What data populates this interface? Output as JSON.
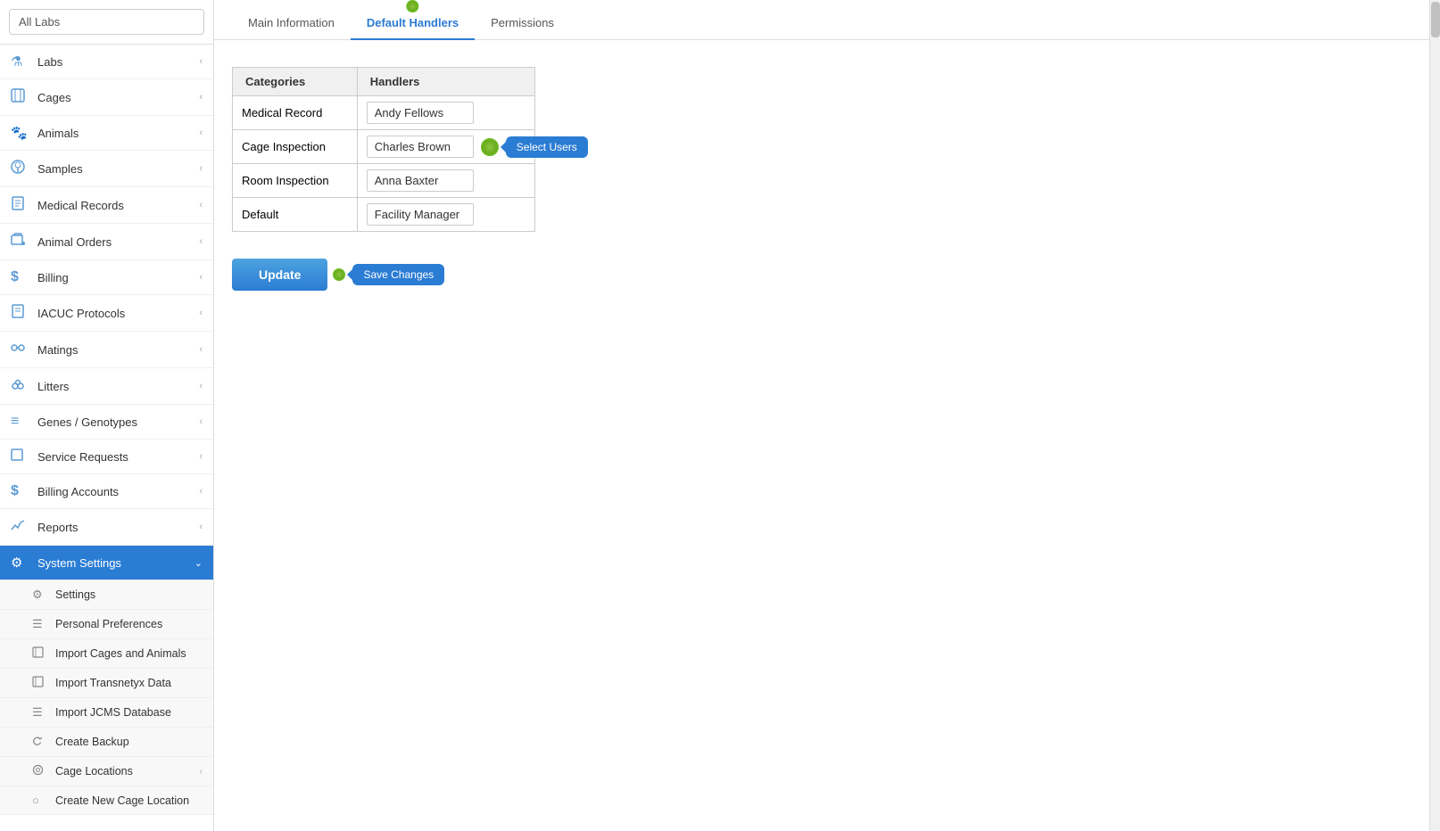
{
  "sidebar": {
    "search_placeholder": "All Labs",
    "items": [
      {
        "id": "labs",
        "label": "Labs",
        "icon": "⚗",
        "has_chevron": true
      },
      {
        "id": "cages",
        "label": "Cages",
        "icon": "🐾",
        "has_chevron": true
      },
      {
        "id": "animals",
        "label": "Animals",
        "icon": "🐾",
        "has_chevron": true
      },
      {
        "id": "samples",
        "label": "Samples",
        "icon": "👤",
        "has_chevron": true
      },
      {
        "id": "medical_records",
        "label": "Medical Records",
        "icon": "📋",
        "has_chevron": true
      },
      {
        "id": "animal_orders",
        "label": "Animal Orders",
        "icon": "🛒",
        "has_chevron": true
      },
      {
        "id": "billing",
        "label": "Billing",
        "icon": "$",
        "has_chevron": true
      },
      {
        "id": "iacuc",
        "label": "IACUC Protocols",
        "icon": "📄",
        "has_chevron": true
      },
      {
        "id": "matings",
        "label": "Matings",
        "icon": "🔗",
        "has_chevron": true
      },
      {
        "id": "litters",
        "label": "Litters",
        "icon": "🐭",
        "has_chevron": true
      },
      {
        "id": "genes",
        "label": "Genes / Genotypes",
        "icon": "≡",
        "has_chevron": true
      },
      {
        "id": "service_requests",
        "label": "Service Requests",
        "icon": "□",
        "has_chevron": true
      },
      {
        "id": "billing_accounts",
        "label": "Billing Accounts",
        "icon": "$",
        "has_chevron": true
      },
      {
        "id": "reports",
        "label": "Reports",
        "icon": "📈",
        "has_chevron": true
      },
      {
        "id": "system_settings",
        "label": "System Settings",
        "icon": "⚙",
        "has_chevron": true,
        "active": true
      }
    ],
    "sub_items": [
      {
        "id": "settings",
        "label": "Settings",
        "icon": "⚙"
      },
      {
        "id": "personal_preferences",
        "label": "Personal Preferences",
        "icon": "☰"
      },
      {
        "id": "import_cages",
        "label": "Import Cages and Animals",
        "icon": "📄"
      },
      {
        "id": "import_transnetyx",
        "label": "Import Transnetyx Data",
        "icon": "📄"
      },
      {
        "id": "import_jcms",
        "label": "Import JCMS Database",
        "icon": "☰"
      },
      {
        "id": "create_backup",
        "label": "Create Backup",
        "icon": "💾"
      },
      {
        "id": "cage_locations",
        "label": "Cage Locations",
        "icon": "⊙",
        "has_chevron": true
      },
      {
        "id": "create_new_cage_location",
        "label": "Create New Cage Location",
        "icon": "○"
      }
    ]
  },
  "tabs": [
    {
      "id": "main_information",
      "label": "Main Information"
    },
    {
      "id": "default_handlers",
      "label": "Default Handlers",
      "active": true
    },
    {
      "id": "permissions",
      "label": "Permissions"
    }
  ],
  "tooltips": {
    "tab_tooltip": "Default Handlers",
    "select_users": "Select Users",
    "save_changes": "Save Changes"
  },
  "table": {
    "col_categories": "Categories",
    "col_handlers": "Handlers",
    "rows": [
      {
        "category": "Medical Record",
        "handler": "Andy Fellows"
      },
      {
        "category": "Cage Inspection",
        "handler": "Charles Brown"
      },
      {
        "category": "Room Inspection",
        "handler": "Anna Baxter"
      },
      {
        "category": "Default",
        "handler": "Facility Manager"
      }
    ]
  },
  "buttons": {
    "update": "Update"
  }
}
